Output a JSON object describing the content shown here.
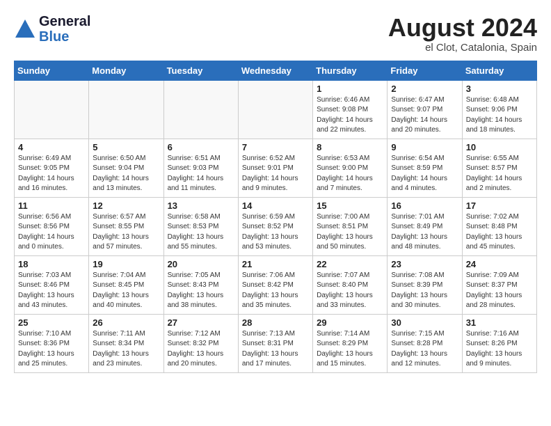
{
  "header": {
    "logo_general": "General",
    "logo_blue": "Blue",
    "month_year": "August 2024",
    "location": "el Clot, Catalonia, Spain"
  },
  "weekdays": [
    "Sunday",
    "Monday",
    "Tuesday",
    "Wednesday",
    "Thursday",
    "Friday",
    "Saturday"
  ],
  "weeks": [
    [
      {
        "day": "",
        "info": ""
      },
      {
        "day": "",
        "info": ""
      },
      {
        "day": "",
        "info": ""
      },
      {
        "day": "",
        "info": ""
      },
      {
        "day": "1",
        "info": "Sunrise: 6:46 AM\nSunset: 9:08 PM\nDaylight: 14 hours\nand 22 minutes."
      },
      {
        "day": "2",
        "info": "Sunrise: 6:47 AM\nSunset: 9:07 PM\nDaylight: 14 hours\nand 20 minutes."
      },
      {
        "day": "3",
        "info": "Sunrise: 6:48 AM\nSunset: 9:06 PM\nDaylight: 14 hours\nand 18 minutes."
      }
    ],
    [
      {
        "day": "4",
        "info": "Sunrise: 6:49 AM\nSunset: 9:05 PM\nDaylight: 14 hours\nand 16 minutes."
      },
      {
        "day": "5",
        "info": "Sunrise: 6:50 AM\nSunset: 9:04 PM\nDaylight: 14 hours\nand 13 minutes."
      },
      {
        "day": "6",
        "info": "Sunrise: 6:51 AM\nSunset: 9:03 PM\nDaylight: 14 hours\nand 11 minutes."
      },
      {
        "day": "7",
        "info": "Sunrise: 6:52 AM\nSunset: 9:01 PM\nDaylight: 14 hours\nand 9 minutes."
      },
      {
        "day": "8",
        "info": "Sunrise: 6:53 AM\nSunset: 9:00 PM\nDaylight: 14 hours\nand 7 minutes."
      },
      {
        "day": "9",
        "info": "Sunrise: 6:54 AM\nSunset: 8:59 PM\nDaylight: 14 hours\nand 4 minutes."
      },
      {
        "day": "10",
        "info": "Sunrise: 6:55 AM\nSunset: 8:57 PM\nDaylight: 14 hours\nand 2 minutes."
      }
    ],
    [
      {
        "day": "11",
        "info": "Sunrise: 6:56 AM\nSunset: 8:56 PM\nDaylight: 14 hours\nand 0 minutes."
      },
      {
        "day": "12",
        "info": "Sunrise: 6:57 AM\nSunset: 8:55 PM\nDaylight: 13 hours\nand 57 minutes."
      },
      {
        "day": "13",
        "info": "Sunrise: 6:58 AM\nSunset: 8:53 PM\nDaylight: 13 hours\nand 55 minutes."
      },
      {
        "day": "14",
        "info": "Sunrise: 6:59 AM\nSunset: 8:52 PM\nDaylight: 13 hours\nand 53 minutes."
      },
      {
        "day": "15",
        "info": "Sunrise: 7:00 AM\nSunset: 8:51 PM\nDaylight: 13 hours\nand 50 minutes."
      },
      {
        "day": "16",
        "info": "Sunrise: 7:01 AM\nSunset: 8:49 PM\nDaylight: 13 hours\nand 48 minutes."
      },
      {
        "day": "17",
        "info": "Sunrise: 7:02 AM\nSunset: 8:48 PM\nDaylight: 13 hours\nand 45 minutes."
      }
    ],
    [
      {
        "day": "18",
        "info": "Sunrise: 7:03 AM\nSunset: 8:46 PM\nDaylight: 13 hours\nand 43 minutes."
      },
      {
        "day": "19",
        "info": "Sunrise: 7:04 AM\nSunset: 8:45 PM\nDaylight: 13 hours\nand 40 minutes."
      },
      {
        "day": "20",
        "info": "Sunrise: 7:05 AM\nSunset: 8:43 PM\nDaylight: 13 hours\nand 38 minutes."
      },
      {
        "day": "21",
        "info": "Sunrise: 7:06 AM\nSunset: 8:42 PM\nDaylight: 13 hours\nand 35 minutes."
      },
      {
        "day": "22",
        "info": "Sunrise: 7:07 AM\nSunset: 8:40 PM\nDaylight: 13 hours\nand 33 minutes."
      },
      {
        "day": "23",
        "info": "Sunrise: 7:08 AM\nSunset: 8:39 PM\nDaylight: 13 hours\nand 30 minutes."
      },
      {
        "day": "24",
        "info": "Sunrise: 7:09 AM\nSunset: 8:37 PM\nDaylight: 13 hours\nand 28 minutes."
      }
    ],
    [
      {
        "day": "25",
        "info": "Sunrise: 7:10 AM\nSunset: 8:36 PM\nDaylight: 13 hours\nand 25 minutes."
      },
      {
        "day": "26",
        "info": "Sunrise: 7:11 AM\nSunset: 8:34 PM\nDaylight: 13 hours\nand 23 minutes."
      },
      {
        "day": "27",
        "info": "Sunrise: 7:12 AM\nSunset: 8:32 PM\nDaylight: 13 hours\nand 20 minutes."
      },
      {
        "day": "28",
        "info": "Sunrise: 7:13 AM\nSunset: 8:31 PM\nDaylight: 13 hours\nand 17 minutes."
      },
      {
        "day": "29",
        "info": "Sunrise: 7:14 AM\nSunset: 8:29 PM\nDaylight: 13 hours\nand 15 minutes."
      },
      {
        "day": "30",
        "info": "Sunrise: 7:15 AM\nSunset: 8:28 PM\nDaylight: 13 hours\nand 12 minutes."
      },
      {
        "day": "31",
        "info": "Sunrise: 7:16 AM\nSunset: 8:26 PM\nDaylight: 13 hours\nand 9 minutes."
      }
    ]
  ]
}
